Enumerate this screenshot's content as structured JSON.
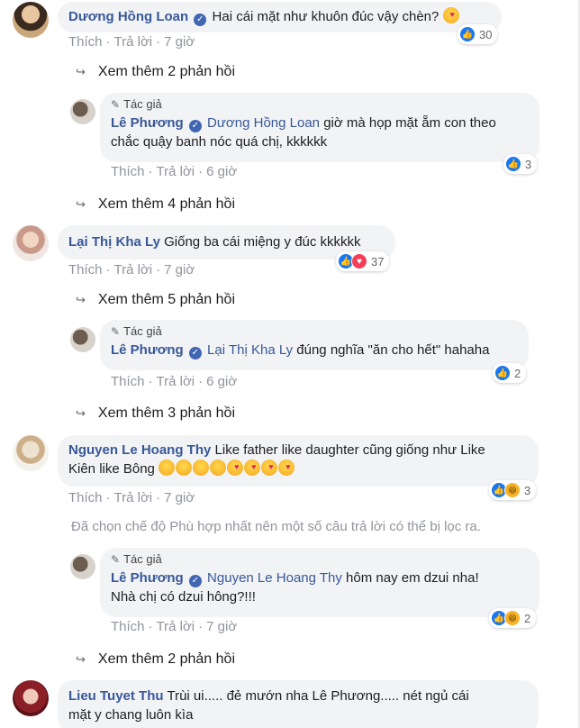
{
  "labels": {
    "like": "Thích",
    "reply": "Trả lời",
    "author_badge": "Tác giả",
    "dot": "·"
  },
  "comments": [
    {
      "author": "Dương Hồng Loan",
      "text": "Hai cái mặt như khuôn đúc vậy chèn?",
      "time": "7 giờ",
      "reaction_count": "30",
      "more_replies": "Xem thêm 2 phản hồi"
    },
    {
      "author": "Lê Phương",
      "mention": "Dương Hồng Loan",
      "text_line1": "giờ mà họp mặt ẵm con theo",
      "text_line2": "chắc quậy banh nóc quá chị, kkkkkk",
      "time": "6 giờ",
      "reaction_count": "3",
      "more_replies": "Xem thêm 4 phản hồi"
    },
    {
      "author": "Lại Thị Kha Ly",
      "text": "Giống ba cái miệng y đúc kkkkkk",
      "time": "7 giờ",
      "reaction_count": "37",
      "more_replies": "Xem thêm 5 phản hồi"
    },
    {
      "author": "Lê Phương",
      "mention": "Lại Thị Kha Ly",
      "text": "đúng nghĩa \"ăn cho hết\" hahaha",
      "time": "6 giờ",
      "reaction_count": "2",
      "more_replies": "Xem thêm 3 phản hồi"
    },
    {
      "author": "Nguyen Le Hoang Thy",
      "text_line1": "Like father like daughter cũng giống như Like",
      "text_line2": "Kiên like Bông",
      "time": "7 giờ",
      "reaction_count": "3"
    },
    {
      "author": "Lê Phương",
      "mention": "Nguyen Le Hoang Thy",
      "text_line1": "hôm nay em dzui nha!",
      "text_line2": "Nhà chị có dzui hông?!!!",
      "time": "7 giờ",
      "reaction_count": "2",
      "more_replies": "Xem thêm 2 phản hồi"
    },
    {
      "author": "Lieu Tuyet Thu",
      "text_line1": "Trùi ui..... đẻ mướn nha Lê Phương..... nét ngủ cái",
      "text_line2": "mặt y chang luôn kìa"
    }
  ],
  "filter_note": "Đã chọn chế độ Phù hợp nhất nên một số câu trả lời có thể bị lọc ra."
}
